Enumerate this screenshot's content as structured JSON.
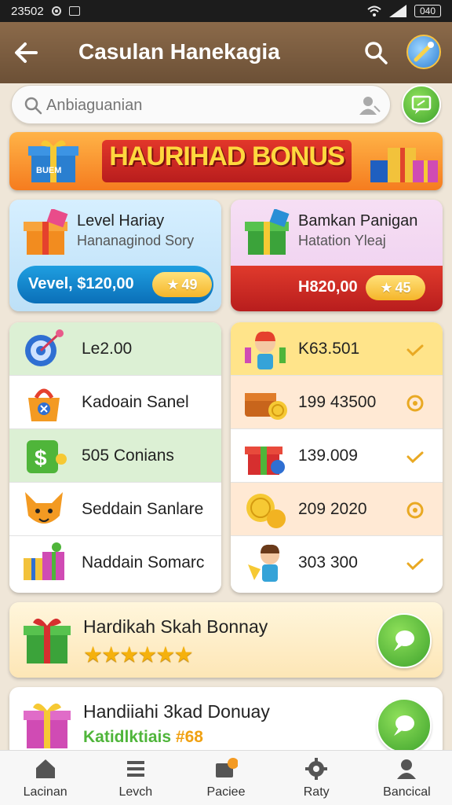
{
  "status_bar": {
    "time": "23502",
    "battery": "040"
  },
  "app_bar": {
    "title": "Casulan Hanekagia"
  },
  "search": {
    "placeholder": "Anbiaguanian"
  },
  "banner": {
    "text": "HAURIHAD BONUS",
    "gift_label": "BUEM"
  },
  "cards": [
    {
      "title": "Level Hariay",
      "subtitle": "Hananaginod Sory",
      "bar_text": "Vevel, $120,00",
      "pill": "49"
    },
    {
      "title": "Bamkan Panigan",
      "subtitle": "Hatation Yleaj",
      "bar_text": "H820,00",
      "pill": "45"
    }
  ],
  "list_left": [
    {
      "text": "Le2.00",
      "icon": "target-icon"
    },
    {
      "text": "Kadoain Sanel",
      "icon": "lock-bag-icon"
    },
    {
      "text": "505 Conians",
      "icon": "money-icon"
    },
    {
      "text": "Seddain Sanlare",
      "icon": "fox-icon"
    },
    {
      "text": "Naddain Somarc",
      "icon": "gift-boxes-icon"
    }
  ],
  "list_right": [
    {
      "text": "K63.501",
      "icon": "kid-icon",
      "end": "check-icon"
    },
    {
      "text": "199 43500",
      "icon": "chest-icon",
      "end": "circle-icon"
    },
    {
      "text": "139.009",
      "icon": "gift-icon",
      "end": "check-icon"
    },
    {
      "text": "209 2020",
      "icon": "coins-icon",
      "end": "circle-icon"
    },
    {
      "text": "303 300",
      "icon": "boy-icon",
      "end": "check-icon"
    }
  ],
  "promos": [
    {
      "title": "Hardikah Skah Bonnay",
      "stars": "★★★★★★",
      "rating": 6
    },
    {
      "title": "Handiiahi 3kad Donuay",
      "subtitle": "Katidlktiais",
      "badge": "#68"
    }
  ],
  "bottom_nav": [
    {
      "label": "Lacinan",
      "icon": "home-icon"
    },
    {
      "label": "Levch",
      "icon": "list-icon"
    },
    {
      "label": "Paciee",
      "icon": "wallet-icon"
    },
    {
      "label": "Raty",
      "icon": "gear-icon"
    },
    {
      "label": "Bancical",
      "icon": "profile-icon"
    }
  ],
  "colors": {
    "app_bar": "#6c5036",
    "banner": "#f57c1f",
    "accent_green": "#3da22c",
    "accent_blue": "#0a6fb8",
    "accent_red": "#b81d1d"
  }
}
